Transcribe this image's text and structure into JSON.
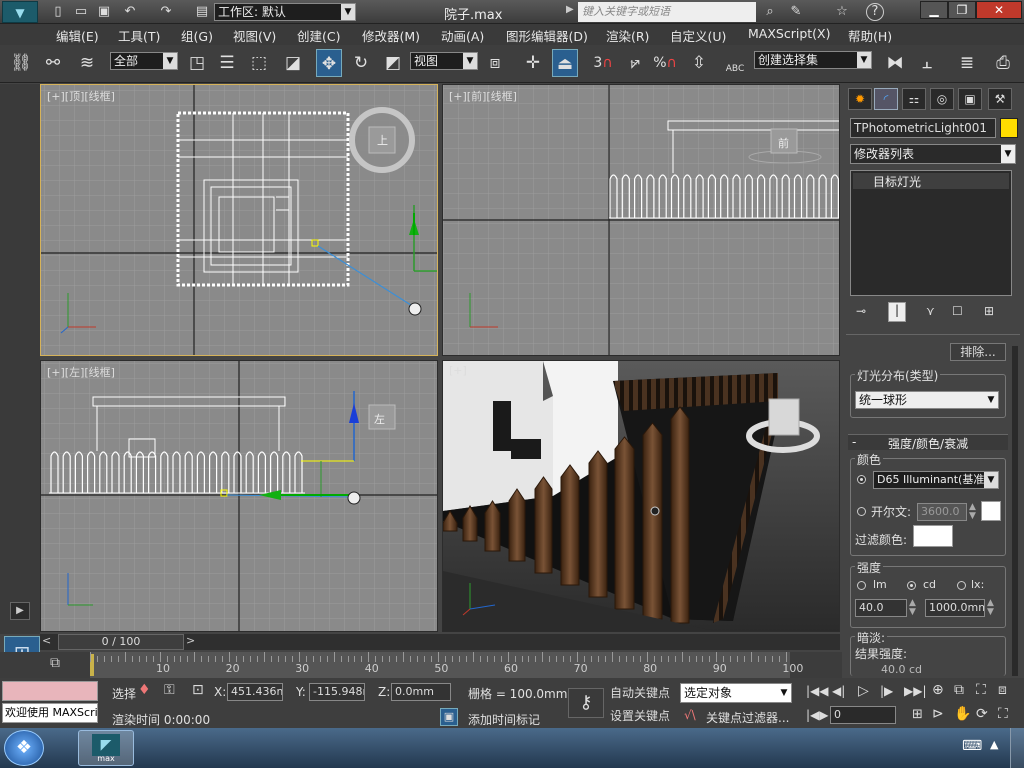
{
  "title_bar": {
    "workspace_label": "工作区: 默认",
    "filename": "院子.max",
    "search_placeholder": "键入关键字或短语",
    "help_symbol": "?"
  },
  "menu": [
    "编辑(E)",
    "工具(T)",
    "组(G)",
    "视图(V)",
    "创建(C)",
    "修改器(M)",
    "动画(A)",
    "图形编辑器(D)",
    "渲染(R)",
    "自定义(U)",
    "MAXScript(X)",
    "帮助(H)"
  ],
  "toolbar": {
    "selection_filter": "全部",
    "reference_coord": "视图",
    "snap_label": "3",
    "percent_label": "%",
    "named_selection": "创建选择集",
    "abc_label": "ABC"
  },
  "viewports": {
    "top": {
      "label": "[+][顶][线框]",
      "cube_label": "上"
    },
    "front": {
      "label": "[+][前][线框]",
      "cube_label": "前"
    },
    "left": {
      "label": "[+][左][线框]",
      "cube_label": "左"
    },
    "persp": {
      "label": "[+]"
    }
  },
  "command_panel": {
    "object_name": "TPhotometricLight001",
    "object_color": "#ffdd00",
    "modifier_list": "修改器列表",
    "stack_item": "目标灯光",
    "exclude_button": "排除...",
    "light_distribution_title": "灯光分布(类型)",
    "light_distribution_value": "统一球形",
    "rollout_minus": "-",
    "intensity_rollout_title": "强度/颜色/衰减",
    "color_group": "颜色",
    "color_preset": "D65 Illuminant(基准白)",
    "kelvin_label": "开尔文:",
    "kelvin_value": "3600.0",
    "filter_color_label": "过滤颜色:",
    "intensity_group": "强度",
    "unit_lm": "lm",
    "unit_cd": "cd",
    "unit_lx": "lx:",
    "intensity_value": "40.0",
    "lx_distance": "1000.0mm",
    "dimming_label": "暗淡:",
    "resulting_intensity_label": "结果强度:",
    "resulting_intensity_value": "40.0 cd"
  },
  "timeline": {
    "frame_display": "0 / 100",
    "ticks": [
      "10",
      "20",
      "30",
      "40",
      "50",
      "60",
      "70",
      "80",
      "90",
      "100"
    ]
  },
  "status": {
    "maxscript_text": "欢迎使用 MAXScri",
    "selection_label": "选择",
    "x_label": "X:",
    "x_value": "451.436mm",
    "y_label": "Y:",
    "y_value": "-115.948mm",
    "z_label": "Z:",
    "z_value": "0.0mm",
    "grid_value": "栅格 = 100.0mm",
    "auto_key": "自动关键点",
    "set_key": "设置关键点",
    "key_mode": "选定对象",
    "key_filters": "关键点过滤器...",
    "render_time": "渲染时间  0:00:00",
    "add_time_tag": "添加时间标记",
    "current_frame": "0"
  },
  "taskbar": {
    "app_label": "max"
  }
}
